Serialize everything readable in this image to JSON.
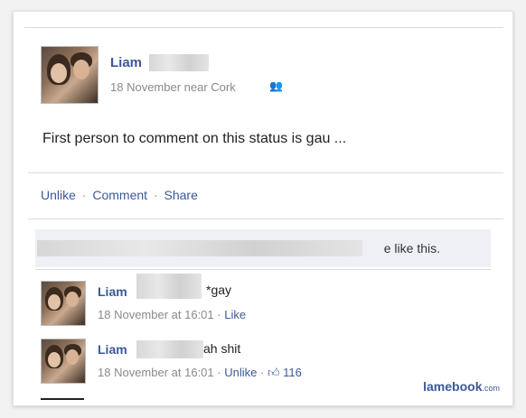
{
  "post": {
    "author": "Liam",
    "meta_date": "18 November near Cork",
    "friends_icon": "friends-icon",
    "status": "First person to comment on this status is gau ..."
  },
  "actions": {
    "unlike": "Unlike",
    "comment": "Comment",
    "share": "Share",
    "separator": "·"
  },
  "likes": {
    "text": "e like this."
  },
  "comments": [
    {
      "author": "Liam",
      "text": "*gay",
      "timestamp": "18 November at 16:01",
      "action": "Like"
    },
    {
      "author": "Liam",
      "text": "ah shit",
      "timestamp": "18 November at 16:01",
      "action": "Unlike",
      "like_count": "116"
    }
  ],
  "watermark": {
    "brand": "lamebook",
    "suffix": ".com"
  }
}
